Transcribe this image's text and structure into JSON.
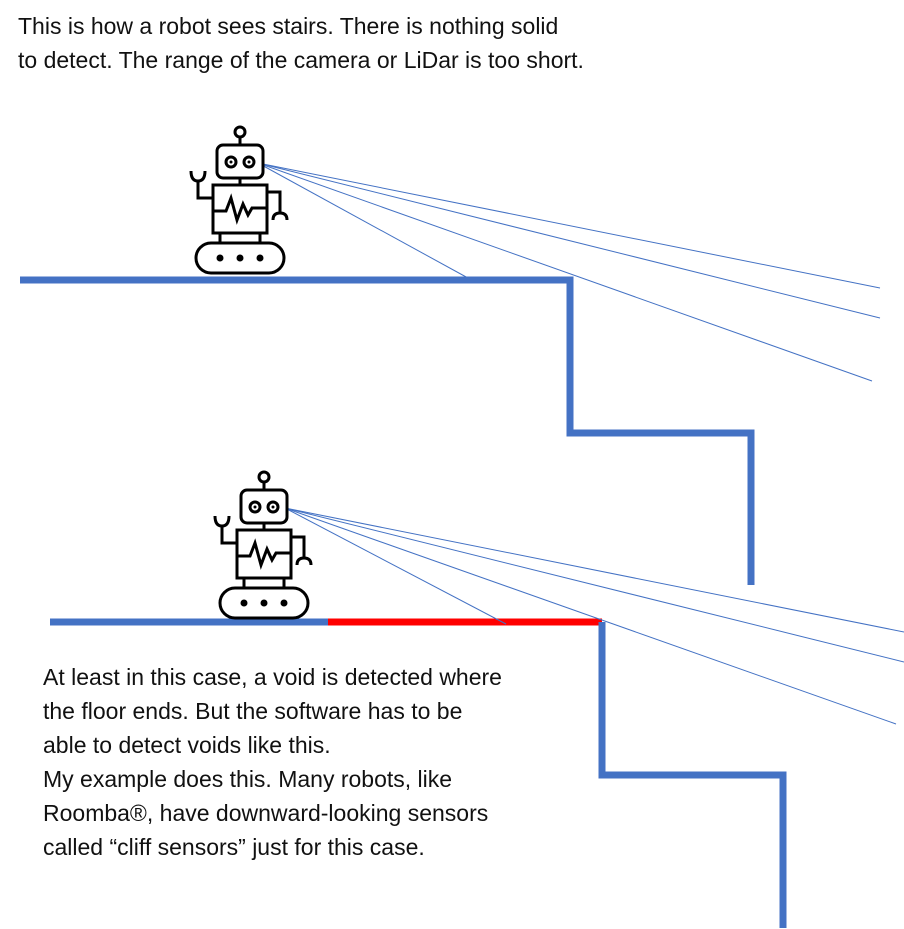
{
  "top_caption": {
    "lines": [
      "This is how a robot sees stairs. There is nothing solid",
      "to detect. The range of the camera or LiDar is too short."
    ]
  },
  "bottom_caption": {
    "lines": [
      "At least in this case, a void is detected where",
      "the floor ends. But the software has to be",
      "able to detect voids like this.",
      "My example does this. Many robots, like",
      "Roomba®, have downward-looking sensors",
      "called “cliff sensors” just for this case."
    ]
  },
  "colors": {
    "floor": "#4472c4",
    "void": "#ff0000",
    "sight_line": "#4472c4",
    "robot": "#000000",
    "text": "#111111"
  },
  "icons": {
    "robot": "robot-icon"
  }
}
